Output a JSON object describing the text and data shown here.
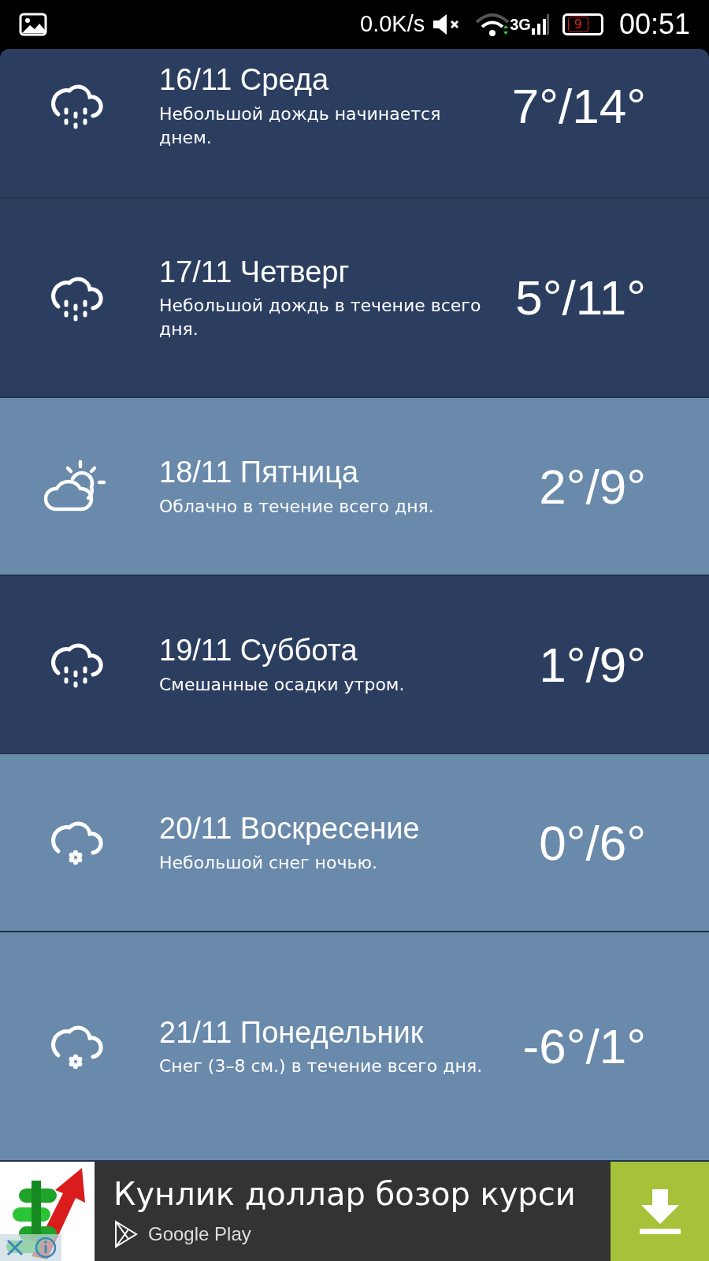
{
  "status_bar": {
    "speed": "0.0K/s",
    "network": "3G",
    "battery": "9",
    "time": "00:51"
  },
  "days": [
    {
      "date": "16/11 Среда",
      "description": "Небольшой дождь начинается днем.",
      "temps": "7°/14°",
      "kind": "rain",
      "color": "#2c3e60"
    },
    {
      "date": "17/11 Четверг",
      "description": "Небольшой дождь в течение всего дня.",
      "temps": "5°/11°",
      "kind": "rain",
      "color": "#2c3e60"
    },
    {
      "date": "18/11 Пятница",
      "description": "Облачно в течение всего дня.",
      "temps": "2°/9°",
      "kind": "partly_cloudy",
      "color": "#6a8aac"
    },
    {
      "date": "19/11 Суббота",
      "description": "Смешанные осадки утром.",
      "temps": "1°/9°",
      "kind": "rain",
      "color": "#2c3e60"
    },
    {
      "date": "20/11 Воскресение",
      "description": "Небольшой снег ночью.",
      "temps": "0°/6°",
      "kind": "snow",
      "color": "#6a8aac"
    },
    {
      "date": "21/11 Понедельник",
      "description": "Снег (3–8 см.) в течение всего дня.",
      "temps": "-6°/1°",
      "kind": "snow",
      "color": "#6a8aac"
    }
  ],
  "ad": {
    "title": "Кунлик доллар бозор курси",
    "store": "Google Play"
  }
}
